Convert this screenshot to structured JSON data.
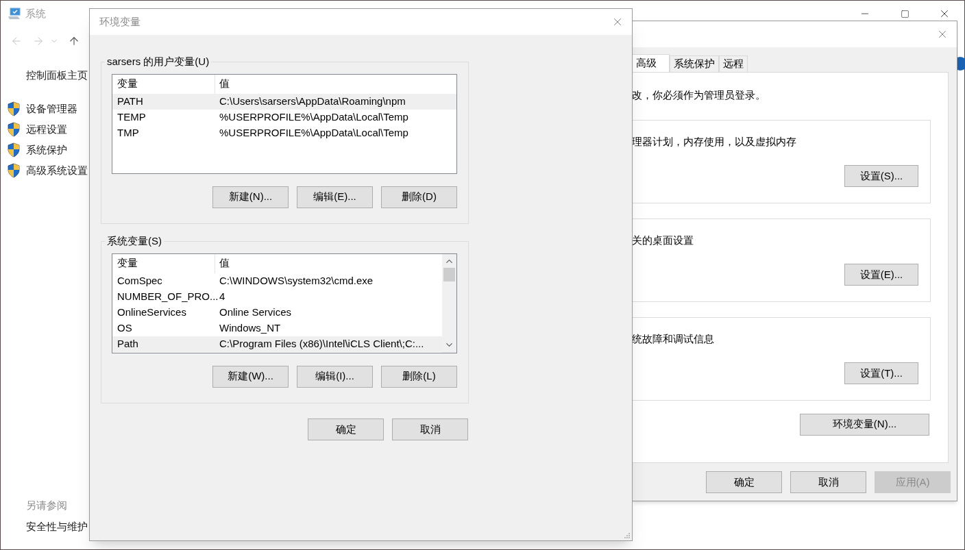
{
  "system_window": {
    "title": "系统",
    "sidebar": {
      "items": [
        {
          "label": "控制面板主页",
          "kind": "link"
        },
        {
          "label": "设备管理器",
          "kind": "shield"
        },
        {
          "label": "远程设置",
          "kind": "shield"
        },
        {
          "label": "系统保护",
          "kind": "shield"
        },
        {
          "label": "高级系统设置",
          "kind": "shield"
        }
      ]
    },
    "see_also": {
      "heading": "另请参阅",
      "items": [
        "安全性与维护"
      ]
    }
  },
  "system_properties": {
    "tabs": [
      {
        "label": "高级",
        "selected": true
      },
      {
        "label": "系统保护",
        "selected": false
      },
      {
        "label": "远程",
        "selected": false
      }
    ],
    "notice": "改，你必须作为管理员登录。",
    "groups": [
      {
        "text": "理器计划，内存使用，以及虚拟内存",
        "button": "设置(S)..."
      },
      {
        "text": "关的桌面设置",
        "button": "设置(E)..."
      },
      {
        "text": "统故障和调试信息",
        "button": "设置(T)..."
      }
    ],
    "env_button": "环境变量(N)...",
    "buttons": [
      {
        "label": "确定",
        "disabled": false
      },
      {
        "label": "取消",
        "disabled": false
      },
      {
        "label": "应用(A)",
        "disabled": true
      }
    ]
  },
  "env_dialog": {
    "title": "环境变量",
    "sections": [
      {
        "legend": "sarsers 的用户变量(U)",
        "columns": [
          "变量",
          "值"
        ],
        "scrollbar": false,
        "rows": [
          {
            "name": "PATH",
            "value": "C:\\Users\\sarsers\\AppData\\Roaming\\npm",
            "selected": true
          },
          {
            "name": "TEMP",
            "value": "%USERPROFILE%\\AppData\\Local\\Temp",
            "selected": false
          },
          {
            "name": "TMP",
            "value": "%USERPROFILE%\\AppData\\Local\\Temp",
            "selected": false
          }
        ],
        "buttons": [
          "新建(N)...",
          "编辑(E)...",
          "删除(D)"
        ]
      },
      {
        "legend": "系统变量(S)",
        "columns": [
          "变量",
          "值"
        ],
        "scrollbar": true,
        "rows": [
          {
            "name": "ComSpec",
            "value": "C:\\WINDOWS\\system32\\cmd.exe",
            "selected": false
          },
          {
            "name": "NUMBER_OF_PRO...",
            "value": "4",
            "selected": false
          },
          {
            "name": "OnlineServices",
            "value": "Online Services",
            "selected": false
          },
          {
            "name": "OS",
            "value": "Windows_NT",
            "selected": false
          },
          {
            "name": "Path",
            "value": "C:\\Program Files (x86)\\Intel\\iCLS Client\\;C:...",
            "selected": true
          }
        ],
        "buttons": [
          "新建(W)...",
          "编辑(I)...",
          "删除(L)"
        ]
      }
    ],
    "buttons": [
      "确定",
      "取消"
    ]
  }
}
